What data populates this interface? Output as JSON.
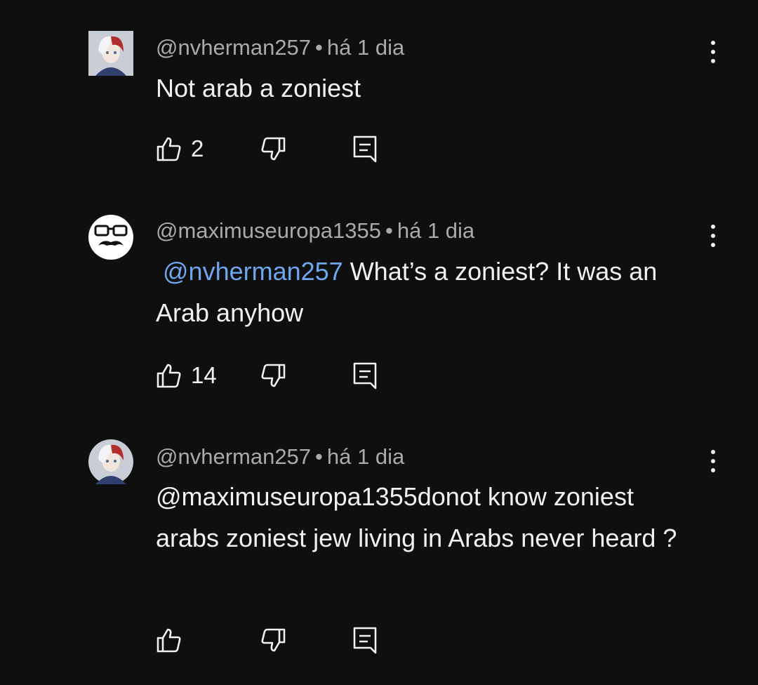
{
  "comments": [
    {
      "handle": "@nvherman257",
      "separator": "•",
      "time": "há 1 dia",
      "mention": "",
      "text": "Not arab a zoniest",
      "likes": "2",
      "avatar": "anime-character-avatar"
    },
    {
      "handle": "@maximuseuropa1355",
      "separator": "•",
      "time": "há 1 dia",
      "mention": "@nvherman257",
      "text": " What’s a zoniest? It was an Arab anyhow",
      "likes": "14",
      "avatar": "glasses-mustache-avatar"
    },
    {
      "handle": "@nvherman257",
      "separator": "•",
      "time": "há 1 dia",
      "mention": "",
      "text": "@maximuseuropa1355donot know zoniest arabs zoniest jew living in Arabs never heard ?",
      "likes": "",
      "avatar": "anime-character-avatar"
    }
  ],
  "icons": {
    "like": "thumbs-up-icon",
    "dislike": "thumbs-down-icon",
    "reply": "reply-comment-icon",
    "more": "more-vertical-icon"
  },
  "colors": {
    "background": "#0f0f0f",
    "text": "#f1f1f1",
    "secondary": "#aaaaaa",
    "mention": "#6ea7f0"
  }
}
